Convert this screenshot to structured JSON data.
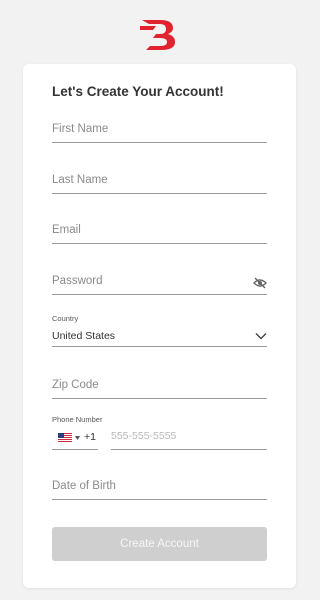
{
  "brand": {
    "logo_icon": "b-brand-logo-icon",
    "accent_color": "#e0232e"
  },
  "form": {
    "title": "Let's Create Your Account!",
    "first_name": {
      "placeholder": "First Name"
    },
    "last_name": {
      "placeholder": "Last Name"
    },
    "email": {
      "placeholder": "Email"
    },
    "password": {
      "placeholder": "Password",
      "toggle_icon": "eye-slash-icon"
    },
    "country": {
      "label": "Country",
      "value": "United States",
      "icon": "chevron-down-icon"
    },
    "zip": {
      "placeholder": "Zip Code"
    },
    "phone": {
      "label": "Phone Number",
      "flag_icon": "us-flag-icon",
      "dial_code": "+1",
      "placeholder": "555-555-5555"
    },
    "dob": {
      "placeholder": "Date of Birth"
    },
    "submit_label": "Create Account",
    "submit_color": "#cfcfcf"
  }
}
